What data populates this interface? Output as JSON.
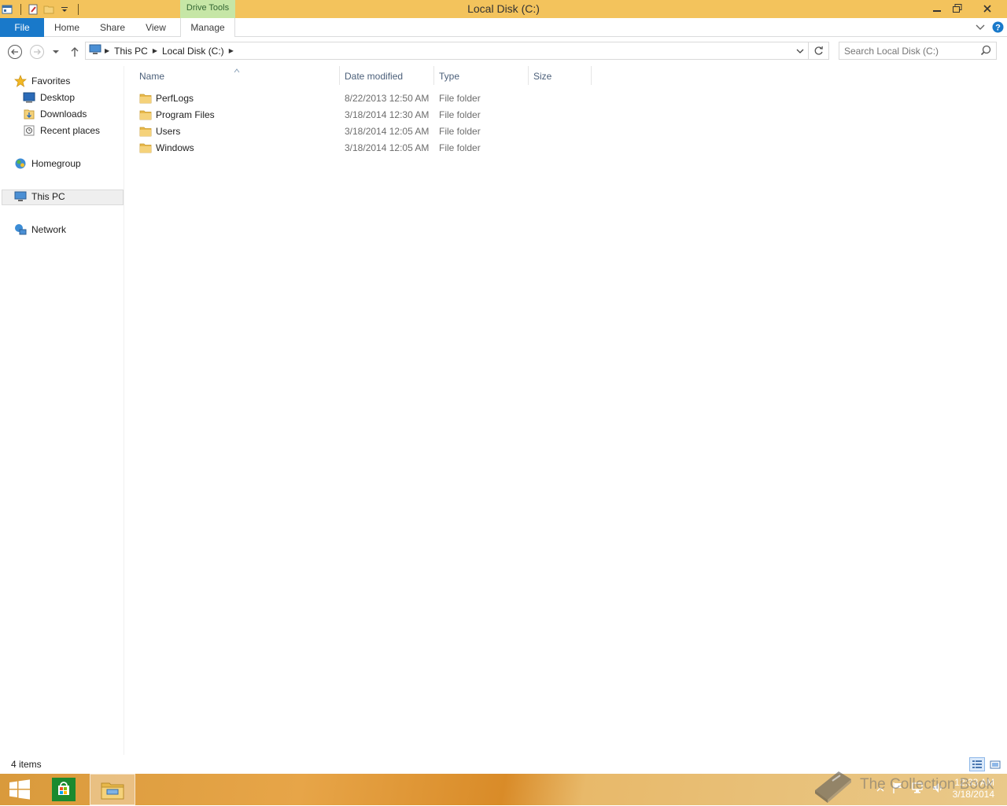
{
  "window": {
    "title": "Local Disk (C:)",
    "contextual_tab_group": "Drive Tools"
  },
  "ribbon": {
    "tabs": [
      "File",
      "Home",
      "Share",
      "View",
      "Manage"
    ]
  },
  "address": {
    "crumbs": [
      "This PC",
      "Local Disk (C:)"
    ]
  },
  "search": {
    "placeholder": "Search Local Disk (C:)"
  },
  "navpane": {
    "favorites": "Favorites",
    "desktop": "Desktop",
    "downloads": "Downloads",
    "recent_places": "Recent places",
    "homegroup": "Homegroup",
    "this_pc": "This PC",
    "network": "Network"
  },
  "columns": {
    "name": "Name",
    "date_modified": "Date modified",
    "type": "Type",
    "size": "Size"
  },
  "files": [
    {
      "name": "PerfLogs",
      "date": "8/22/2013 12:50 AM",
      "type": "File folder"
    },
    {
      "name": "Program Files",
      "date": "3/18/2014 12:30 AM",
      "type": "File folder"
    },
    {
      "name": "Users",
      "date": "3/18/2014 12:05 AM",
      "type": "File folder"
    },
    {
      "name": "Windows",
      "date": "3/18/2014 12:05 AM",
      "type": "File folder"
    }
  ],
  "status": {
    "item_count": "4 items"
  },
  "taskbar": {
    "time": "12:33 AM",
    "date": "3/18/2014"
  },
  "watermark": {
    "text": "The Collection Book"
  },
  "colors": {
    "title_bar": "#f3c35c",
    "file_tab": "#1979ca",
    "contextual_tab": "#c6e6a6",
    "folder": "#e8b84a"
  }
}
